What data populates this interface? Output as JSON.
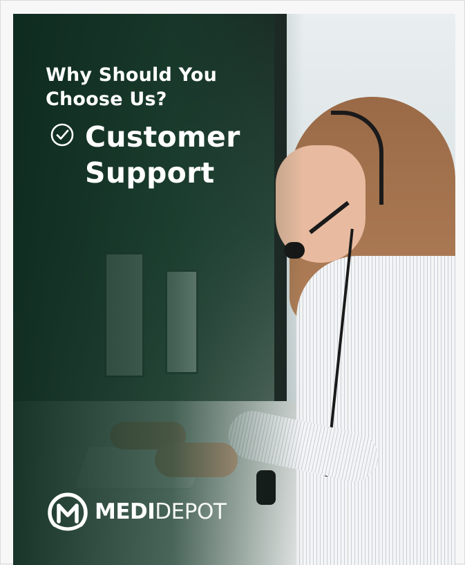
{
  "heading": {
    "line1": "Why Should You",
    "line2": "Choose Us?"
  },
  "feature": {
    "icon": "check-circle-icon",
    "line1": "Customer",
    "line2": "Support"
  },
  "brand": {
    "logo_icon": "medidepot-logo-icon",
    "part1": "MEDI",
    "part2": "DEPOT"
  },
  "colors": {
    "overlay": "#163a2a",
    "text": "#ffffff",
    "background": "#f3f3f3"
  }
}
